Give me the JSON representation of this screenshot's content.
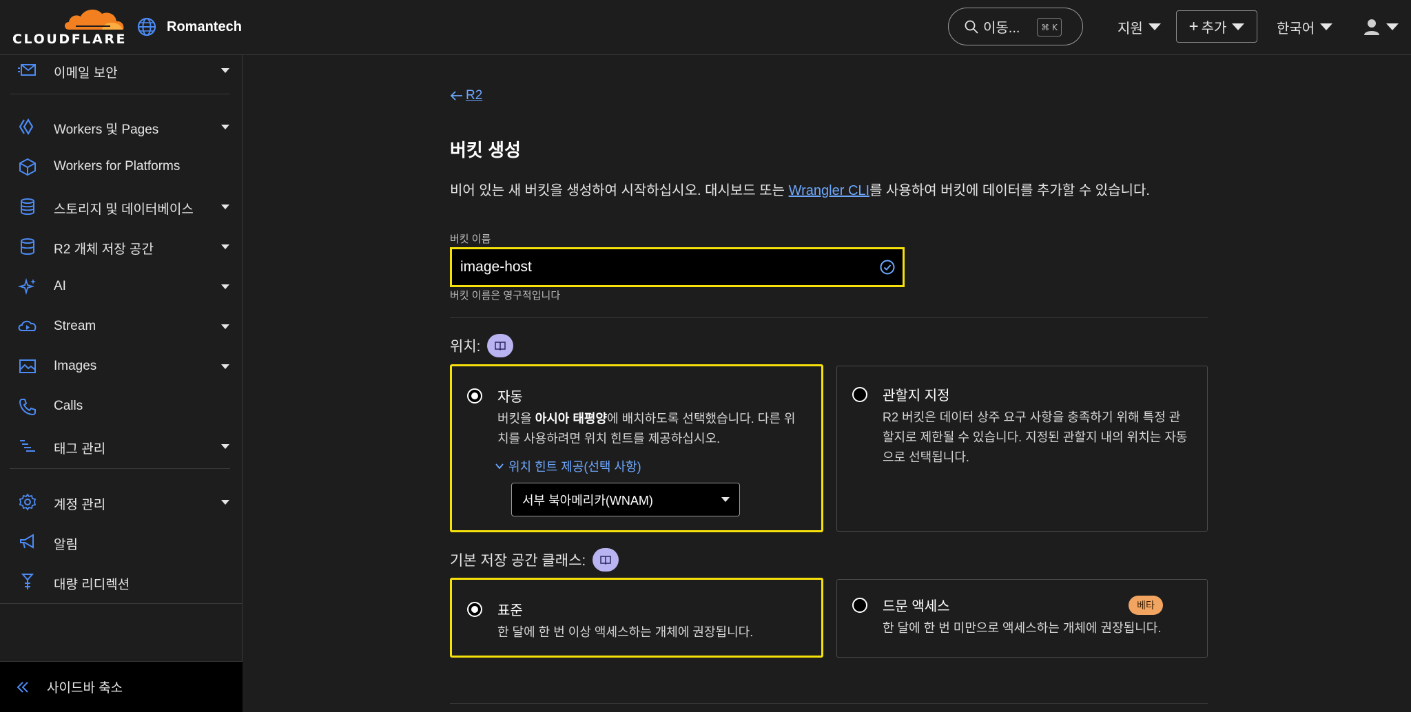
{
  "header": {
    "logo_text": "CLOUDFLARE",
    "account_name": "Romantech",
    "goto_label": "이동...",
    "goto_shortcut": "⌘ K",
    "support_label": "지원",
    "add_label": "추가",
    "language_label": "한국어"
  },
  "sidebar": {
    "items": [
      {
        "label": "이메일 보안",
        "icon": "envelope-icon"
      },
      {
        "label": "Workers 및 Pages",
        "icon": "workers-icon"
      },
      {
        "label": "Workers for Platforms",
        "icon": "cube-icon"
      },
      {
        "label": "스토리지 및 데이터베이스",
        "icon": "database-icon"
      },
      {
        "label": "R2 개체 저장 공간",
        "icon": "storage-icon"
      },
      {
        "label": "AI",
        "icon": "sparkle-icon"
      },
      {
        "label": "Stream",
        "icon": "stream-icon"
      },
      {
        "label": "Images",
        "icon": "image-icon"
      },
      {
        "label": "Calls",
        "icon": "phone-icon"
      },
      {
        "label": "태그 관리",
        "icon": "tag-icon"
      },
      {
        "label": "계정 관리",
        "icon": "gear-icon"
      },
      {
        "label": "알림",
        "icon": "megaphone-icon"
      },
      {
        "label": "대량 리디렉션",
        "icon": "redirect-icon"
      }
    ],
    "collapse_label": "사이드바 축소"
  },
  "main": {
    "back_label": "R2",
    "title": "버킷 생성",
    "desc_before": "비어 있는 새 버킷을 생성하여 시작하십시오. 대시보드 또는 ",
    "desc_link": "Wrangler CLI",
    "desc_after": "를 사용하여 버킷에 데이터를 추가할 수 있습니다.",
    "bucket_name_label": "버킷 이름",
    "bucket_name_value": "image-host",
    "bucket_name_help": "버킷 이름은 영구적입니다",
    "location": {
      "label": "위치:",
      "auto": {
        "title": "자동",
        "desc_before": "버킷을 ",
        "desc_bold": "아시아 태평양",
        "desc_after_line1": "에 배치하도록 선택했습니다. 다른 위",
        "desc_line2": "치를 사용하려면 위치 힌트를 제공하십시오.",
        "hint_toggle": "위치 힌트 제공(선택 사항)",
        "hint_value": "서부 북아메리카(WNAM)",
        "selected": true
      },
      "jurisdiction": {
        "title": "관할지 지정",
        "desc_line1": "R2 버킷은 데이터 상주 요구 사항을 충족하기 위해 특정 관",
        "desc_line2": "할지로 제한될 수 있습니다. 지정된 관할지 내의 위치는 자동",
        "desc_line3": "으로 선택됩니다.",
        "selected": false
      }
    },
    "storage_class": {
      "label": "기본 저장 공간 클래스:",
      "standard": {
        "title": "표준",
        "desc": "한 달에 한 번 이상 액세스하는 개체에 권장됩니다.",
        "selected": true
      },
      "infrequent": {
        "title": "드문 액세스",
        "badge": "베타",
        "desc": "한 달에 한 번 미만으로 액세스하는 개체에 권장됩니다.",
        "selected": false
      }
    }
  },
  "colors": {
    "accent_link": "#6ea8fe",
    "highlight": "#f7e10b",
    "logo_orange": "#f38020",
    "badge_purple": "#b9b3f2",
    "beta_badge": "#f2a561"
  }
}
